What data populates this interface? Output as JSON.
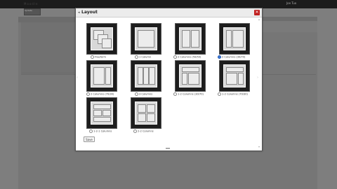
{
  "app": {
    "title": "Moodle",
    "user_text": "Joe Tuo",
    "top_button": "Update"
  },
  "modal": {
    "title": "Layout",
    "close_label": "✕",
    "save_label": "Save",
    "selected": "2 Columns (50/50)",
    "options": [
      {
        "label": "Freeform"
      },
      {
        "label": "1 Column"
      },
      {
        "label": "2 Columns (50/50)"
      },
      {
        "label": "2 Columns (30/70)"
      },
      {
        "label": "2 Columns (70/30)"
      },
      {
        "label": "3 Columns"
      },
      {
        "label": "1-2 Columns (30/70)"
      },
      {
        "label": "1-2 Columns (70/30)"
      },
      {
        "label": "1-2-1 Columns"
      },
      {
        "label": "2-2 Columns"
      }
    ]
  }
}
